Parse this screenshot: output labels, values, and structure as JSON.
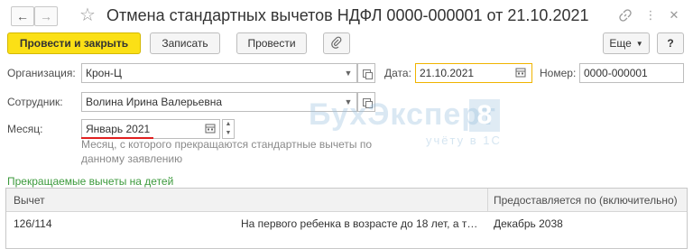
{
  "window": {
    "title": "Отмена стандартных вычетов НДФЛ 0000-000001 от 21.10.2021"
  },
  "toolbar": {
    "post_close_label": "Провести и закрыть",
    "save_label": "Записать",
    "post_label": "Провести",
    "more_label": "Еще",
    "help_label": "?"
  },
  "form": {
    "organization": {
      "label": "Организация:",
      "value": "Крон-Ц"
    },
    "date": {
      "label": "Дата:",
      "value": "21.10.2021"
    },
    "number": {
      "label": "Номер:",
      "value": "0000-000001"
    },
    "employee": {
      "label": "Сотрудник:",
      "value": "Волина Ирина Валерьевна"
    },
    "month": {
      "label": "Месяц:",
      "value": "Январь 2021",
      "hint": "Месяц, с которого прекращаются стандартные вычеты по данному заявлению"
    }
  },
  "section_title": "Прекращаемые вычеты на детей",
  "table": {
    "columns": [
      "Вычет",
      "Предоставляется по (включительно)"
    ],
    "rows": [
      {
        "code": "126/114",
        "description": "На первого ребенка в возрасте до 18 лет, а т…",
        "until": "Декабрь 2038"
      }
    ]
  },
  "watermark": {
    "brand": "БухЭксперт",
    "digit": "8",
    "tagline": "учёту в 1С"
  },
  "colors": {
    "primary_button": "#fbe016",
    "section_title": "#3c9a3c",
    "focus_border": "#f0b400",
    "underline": "#e02020"
  }
}
